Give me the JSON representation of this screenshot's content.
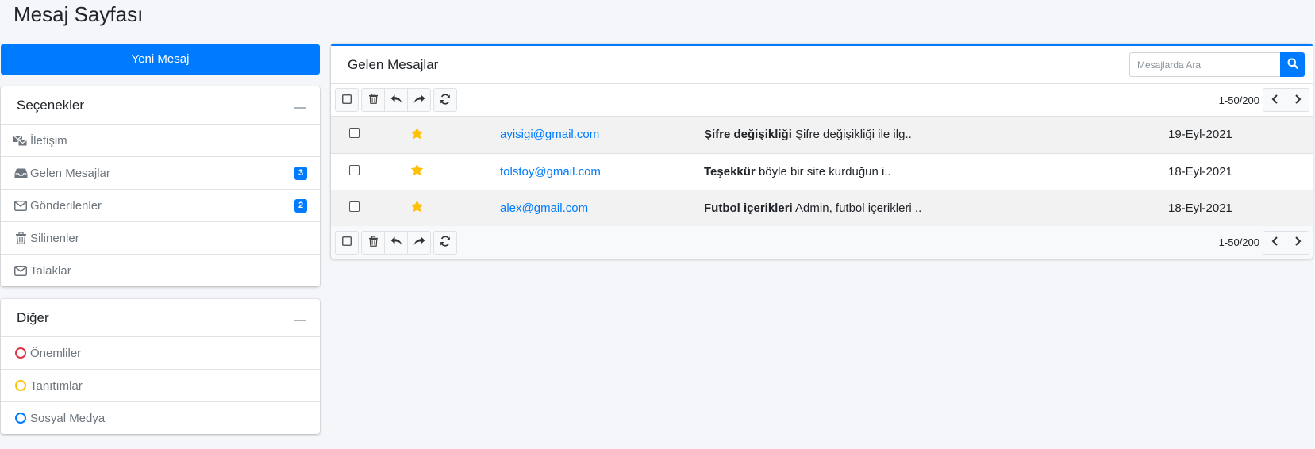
{
  "page": {
    "title": "Mesaj Sayfası"
  },
  "compose": {
    "label": "Yeni Mesaj"
  },
  "options": {
    "title": "Seçenekler",
    "items": [
      {
        "label": "İletişim",
        "icon": "mail-bulk-icon",
        "badge": ""
      },
      {
        "label": "Gelen Mesajlar",
        "icon": "inbox-icon",
        "badge": "3"
      },
      {
        "label": "Gönderilenler",
        "icon": "envelope-icon",
        "badge": "2"
      },
      {
        "label": "Silinenler",
        "icon": "trash-icon",
        "badge": ""
      },
      {
        "label": "Talaklar",
        "icon": "envelope-icon",
        "badge": ""
      }
    ]
  },
  "other": {
    "title": "Diğer",
    "items": [
      {
        "label": "Önemliler",
        "color": "#dc3545"
      },
      {
        "label": "Tanıtımlar",
        "color": "#ffc107"
      },
      {
        "label": "Sosyal Medya",
        "color": "#007bff"
      }
    ]
  },
  "inbox": {
    "title": "Gelen Mesajlar",
    "search_placeholder": "Mesajlarda Ara",
    "pager_text": "1-50/200",
    "accent": "#007bff",
    "star_color": "#ffc107",
    "messages": [
      {
        "from": "ayisigi@gmail.com",
        "subject": "Şifre değişikliği",
        "preview": "Şifre değişikliği ile ilg..",
        "date": "19-Eyl-2021"
      },
      {
        "from": "tolstoy@gmail.com",
        "subject": "Teşekkür",
        "preview": "böyle bir site kurduğun i..",
        "date": "18-Eyl-2021"
      },
      {
        "from": "alex@gmail.com",
        "subject": "Futbol içerikleri",
        "preview": "Admin, futbol içerikleri ..",
        "date": "18-Eyl-2021"
      }
    ]
  }
}
